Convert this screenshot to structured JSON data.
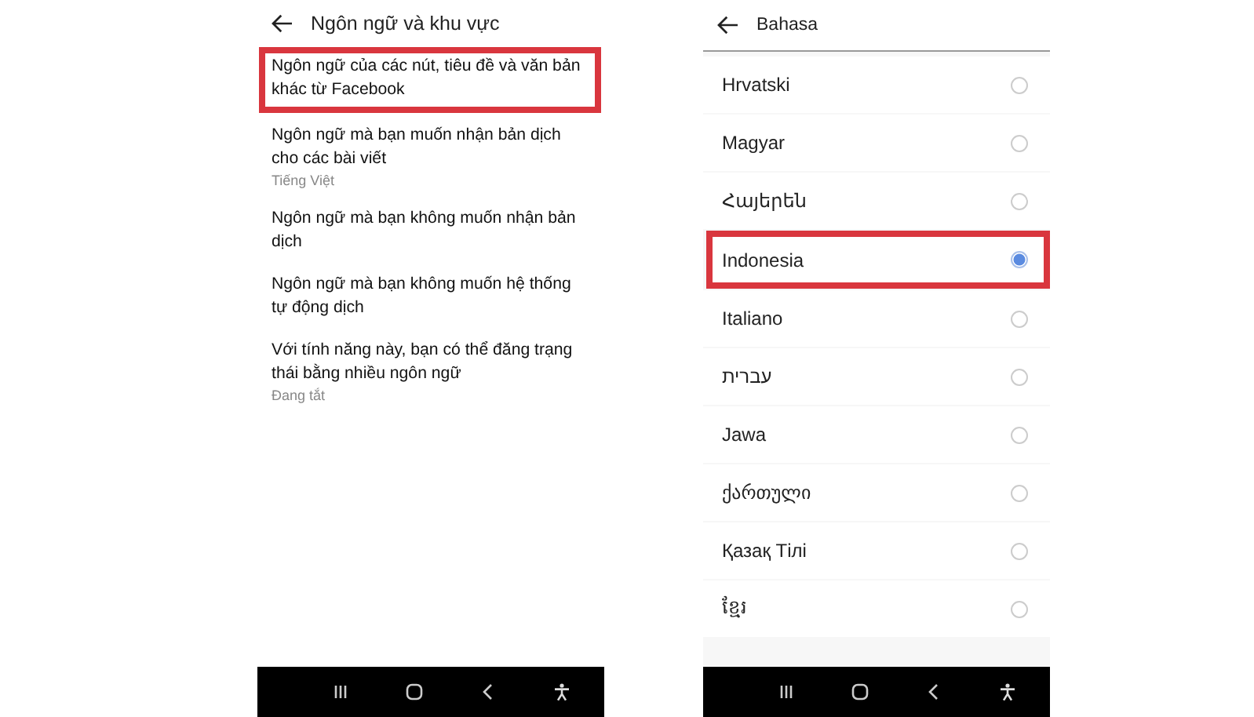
{
  "left_screen": {
    "title": "Ngôn ngữ và khu vực",
    "items": [
      {
        "label": "Ngôn ngữ của các nút, tiêu đề và văn bản khác từ Facebook",
        "highlighted": true
      },
      {
        "label": "Ngôn ngữ mà bạn muốn nhận bản dịch cho các bài viết",
        "value": "Tiếng Việt",
        "highlighted": false
      },
      {
        "label": "Ngôn ngữ mà bạn không muốn nhận bản dịch",
        "highlighted": false
      },
      {
        "label": "Ngôn ngữ mà bạn không muốn hệ thống tự động dịch",
        "highlighted": false
      },
      {
        "label": "Với tính năng này, bạn có thể đăng trạng thái bằng nhiều ngôn ngữ",
        "value": "Đang tắt",
        "highlighted": false
      }
    ]
  },
  "right_screen": {
    "title": "Bahasa",
    "languages": [
      {
        "label": "Hrvatski",
        "selected": false,
        "highlighted": false
      },
      {
        "label": "Magyar",
        "selected": false,
        "highlighted": false
      },
      {
        "label": "Հայերեն",
        "selected": false,
        "highlighted": false
      },
      {
        "label": "Indonesia",
        "selected": true,
        "highlighted": true
      },
      {
        "label": "Italiano",
        "selected": false,
        "highlighted": false
      },
      {
        "label": "עברית",
        "selected": false,
        "highlighted": false
      },
      {
        "label": "Jawa",
        "selected": false,
        "highlighted": false
      },
      {
        "label": "ქართული",
        "selected": false,
        "highlighted": false
      },
      {
        "label": "Қазақ Тілі",
        "selected": false,
        "highlighted": false
      },
      {
        "label": "ខ្មែរ",
        "selected": false,
        "highlighted": false
      }
    ]
  }
}
